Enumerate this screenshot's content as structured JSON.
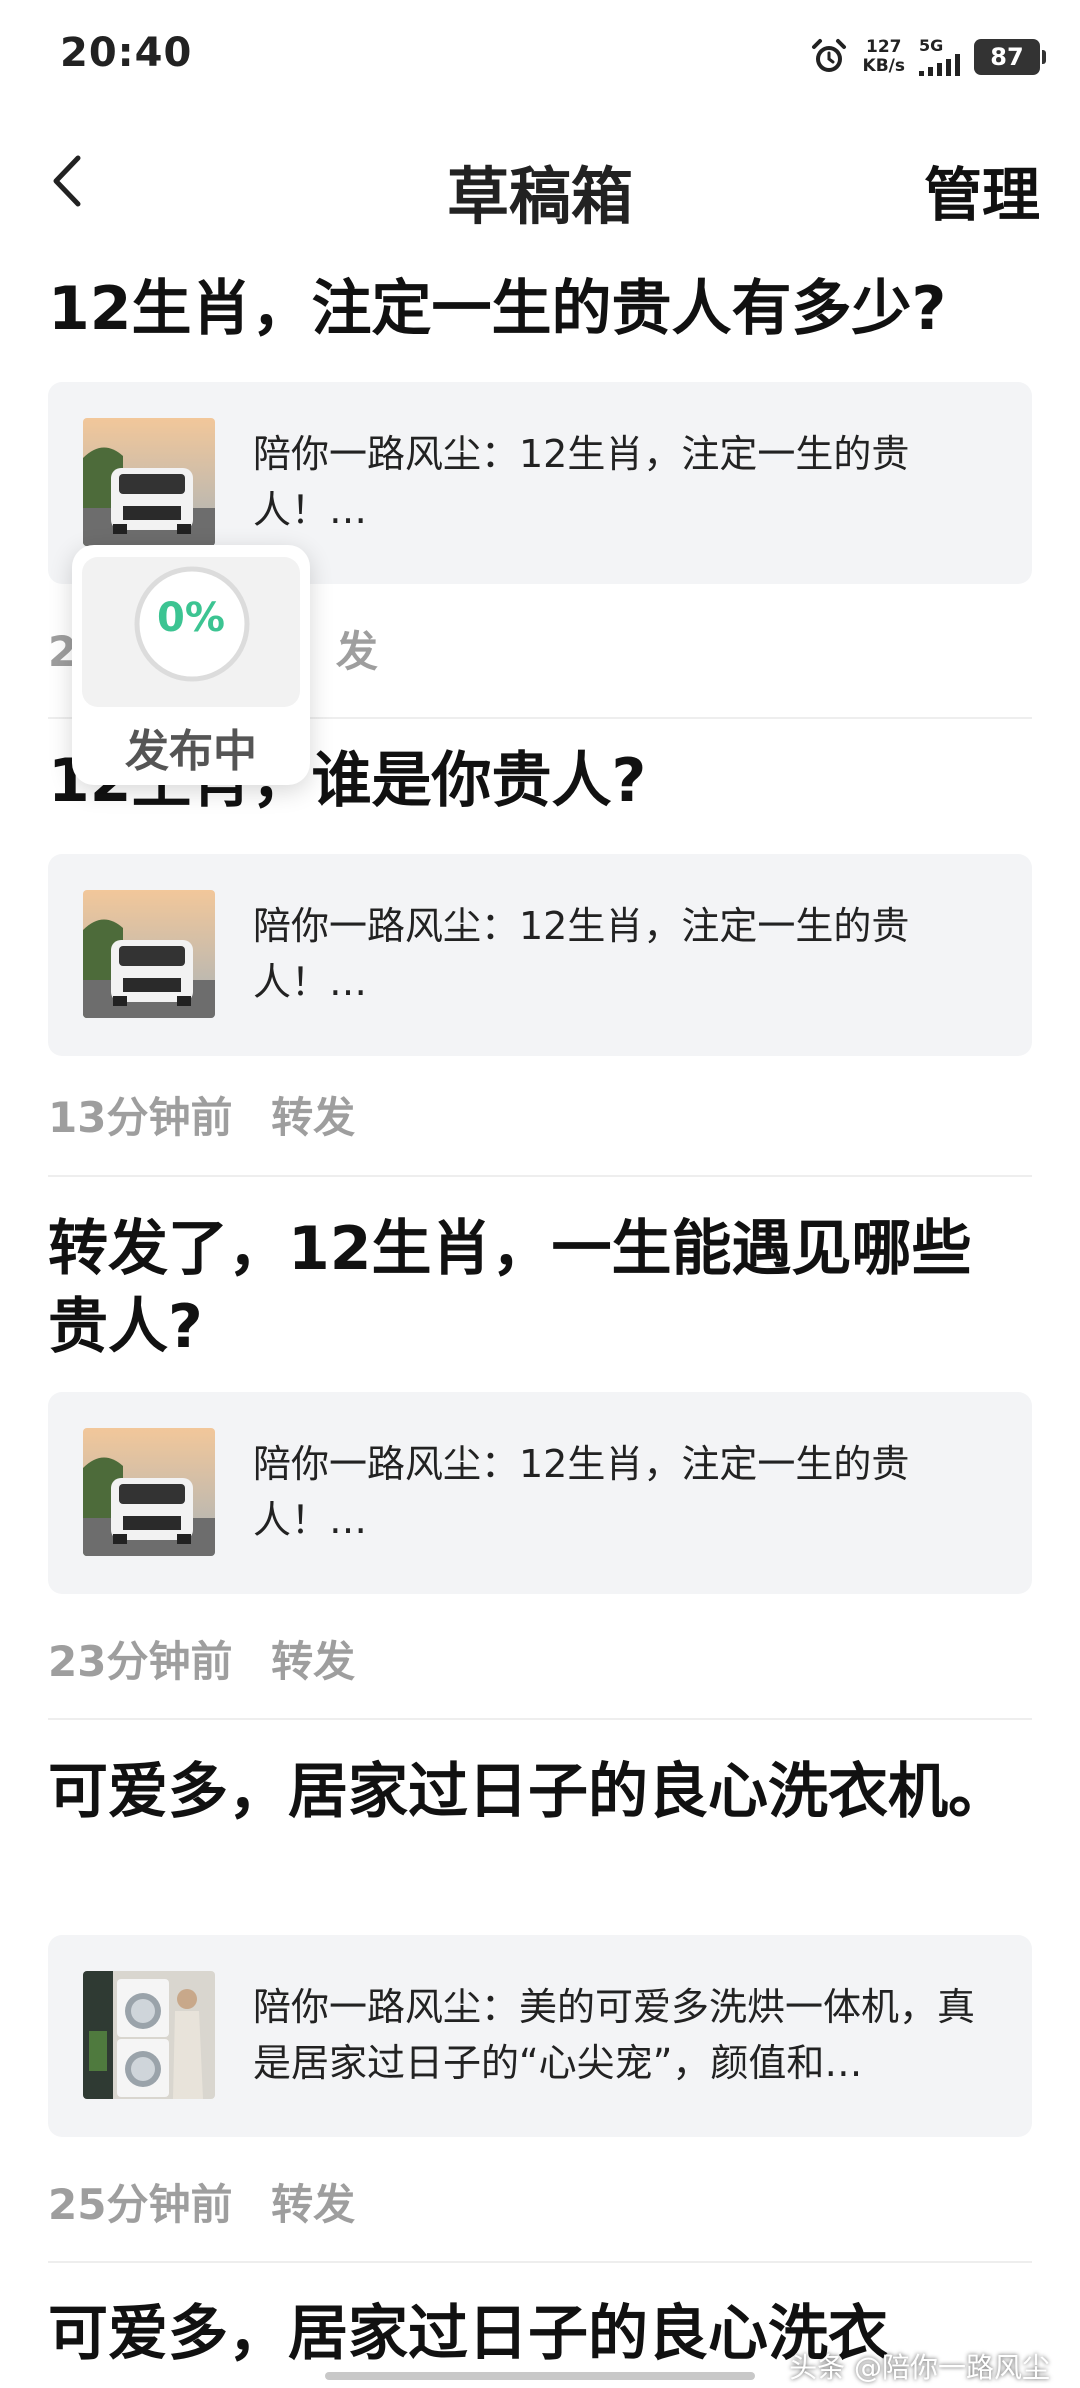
{
  "status_bar": {
    "time": "20:40",
    "net_speed_value": "127",
    "net_speed_unit": "KB/s",
    "signal_label": "5G",
    "battery": "87"
  },
  "nav": {
    "title": "草稿箱",
    "manage_label": "管理"
  },
  "drafts": [
    {
      "title": "12生肖，注定一生的贵人有多少?",
      "preview": "陪你一路风尘：12生肖，注定一生的贵人！…",
      "time": "2",
      "action": "发"
    },
    {
      "title": "12生肖，谁是你贵人?",
      "preview": "陪你一路风尘：12生肖，注定一生的贵人！…",
      "time": "13分钟前",
      "action": "转发"
    },
    {
      "title": "转发了，12生肖，一生能遇见哪些贵人?",
      "preview": "陪你一路风尘：12生肖，注定一生的贵人！…",
      "time": "23分钟前",
      "action": "转发"
    },
    {
      "title": "可爱多，居家过日子的良心洗衣机。",
      "preview": "陪你一路风尘：美的可爱多洗烘一体机，真是居家过日子的“心尖宠”，颜值和…",
      "time": "25分钟前",
      "action": "转发"
    },
    {
      "title": "可爱多，居家过日子的良心洗衣"
    }
  ],
  "publishing_toast": {
    "progress": "0%",
    "progress_fraction": 0,
    "label": "发布中"
  },
  "watermark": "头条 @陪你一路风尘",
  "colors": {
    "accent": "#3cc492",
    "card_bg": "#f3f4f6",
    "meta_text": "#9e9e9e"
  },
  "icons": {
    "back": "chevron-left-icon",
    "alarm": "alarm-clock-icon"
  }
}
